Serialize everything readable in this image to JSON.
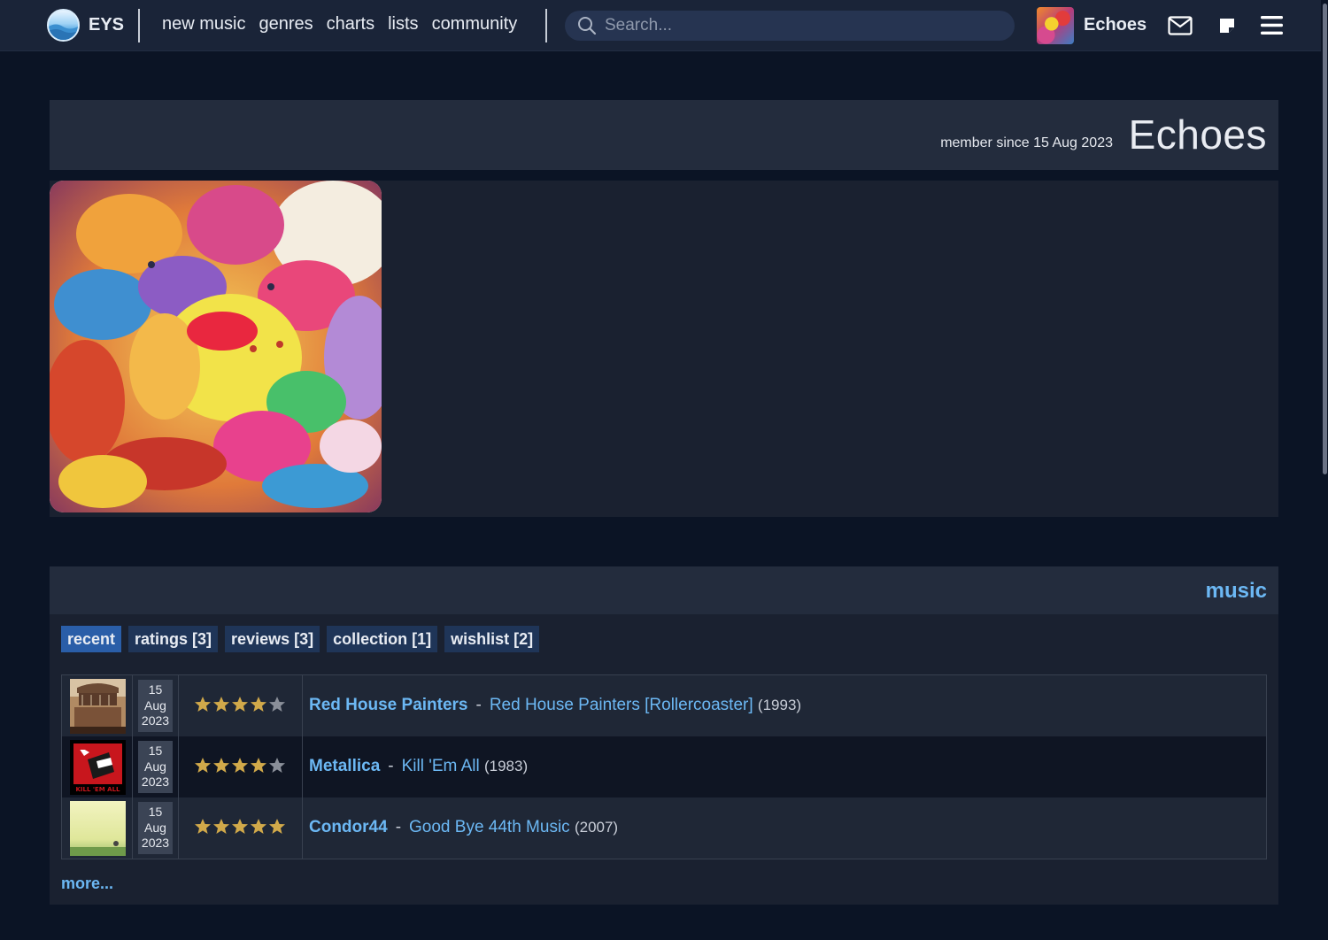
{
  "topbar": {
    "logo_text": "EYS",
    "nav": [
      "new music",
      "genres",
      "charts",
      "lists",
      "community"
    ],
    "search_placeholder": "Search...",
    "user_name": "Echoes"
  },
  "profile": {
    "member_since": "member since 15 Aug 2023",
    "name": "Echoes"
  },
  "music": {
    "title": "music",
    "tabs": [
      {
        "label": "recent",
        "active": true
      },
      {
        "label": "ratings [3]",
        "active": false
      },
      {
        "label": "reviews [3]",
        "active": false
      },
      {
        "label": "collection [1]",
        "active": false
      },
      {
        "label": "wishlist [2]",
        "active": false
      }
    ],
    "entries": [
      {
        "day": "15",
        "month": "Aug",
        "year_added": "2023",
        "rating": 4,
        "artist": "Red House Painters",
        "separator": "-",
        "album": "Red House Painters [Rollercoaster]",
        "album_year": "(1993)"
      },
      {
        "day": "15",
        "month": "Aug",
        "year_added": "2023",
        "rating": 4,
        "artist": "Metallica",
        "separator": "-",
        "album": "Kill 'Em All",
        "album_year": "(1983)"
      },
      {
        "day": "15",
        "month": "Aug",
        "year_added": "2023",
        "rating": 5,
        "artist": "Condor44",
        "separator": "-",
        "album": "Good Bye 44th Music",
        "album_year": "(2007)"
      }
    ],
    "more_label": "more...",
    "max_rating": 5
  },
  "colors": {
    "background": "#0b1425",
    "link": "#6cb8f4",
    "star_filled": "#d1a94a",
    "star_empty": "#8a8f99",
    "tab_active": "#2a5ea8"
  },
  "icons": [
    "logo-icon",
    "search-icon",
    "mail-icon",
    "note-icon",
    "menu-icon"
  ]
}
